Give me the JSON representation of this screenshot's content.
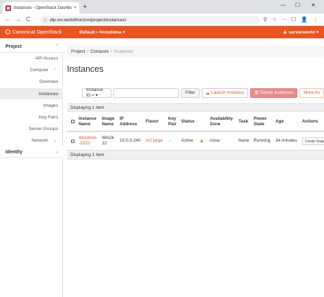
{
  "browser": {
    "tab_title": "Instances - OpenStack Dashboard",
    "tab_close": "×",
    "new_tab": "+",
    "url": "dlp.srv.world/horizon/project/instances/",
    "lock_icon": "ⓘ",
    "minimize": "—",
    "maximize": "☐",
    "close": "✕",
    "back": "←",
    "forward": "→",
    "reload": "C",
    "tools": [
      "⚲",
      "☆",
      "⋯",
      "☐",
      "👤",
      "⋮"
    ]
  },
  "header": {
    "brand": "Canonical OpenStack",
    "project": "Default • hiroshima ▾",
    "user": "serverworld ▾",
    "user_icon": "♟"
  },
  "sidebar": {
    "project_label": "Project",
    "project_chev": "⌃",
    "api_access": "API Access",
    "compute": "Compute",
    "compute_chev": "⌃",
    "overview": "Overview",
    "instances": "Instances",
    "images": "Images",
    "key_pairs": "Key Pairs",
    "server_groups": "Server Groups",
    "network": "Network",
    "network_chev": "⌄",
    "identity_label": "Identity",
    "identity_chev": "⌄"
  },
  "main": {
    "breadcrumb": [
      "Project",
      "Compute",
      "Instances"
    ],
    "breadcrumb_sep": "/",
    "title": "Instances",
    "filter_select": "Instance ID = ▾",
    "filter_btn": "Filter",
    "launch_btn": "Launch Instance",
    "launch_icon": "☁",
    "delete_btn": "Delete Instances",
    "delete_icon": "🗑",
    "more_btn": "More Ac"
  },
  "table": {
    "displaying_top": "Displaying 1 item",
    "displaying_bottom": "Displaying 1 item",
    "headers": {
      "name": [
        "Instance",
        "Name"
      ],
      "image": [
        "Image",
        "Name"
      ],
      "ip": [
        "IP",
        "Address"
      ],
      "flavor": [
        "Flavor"
      ],
      "keypair": [
        "Key",
        "Pair"
      ],
      "status": [
        "Status"
      ],
      "az": [
        "Availability",
        "Zone"
      ],
      "task": [
        "Task"
      ],
      "power": [
        "Power",
        "State"
      ],
      "age": [
        "Age"
      ],
      "actions": [
        "Actions"
      ]
    },
    "row": {
      "name": [
        "Windows",
        "-2022"
      ],
      "image": [
        "Win2k",
        "22"
      ],
      "ip": "10.0.0.240",
      "flavor": "m2.large",
      "keypair": "-",
      "status": "Active",
      "status_icon": "🔒",
      "az": "nova",
      "task": "None",
      "power": "Running",
      "age": "34 minutes",
      "action": "Create Snap"
    }
  }
}
